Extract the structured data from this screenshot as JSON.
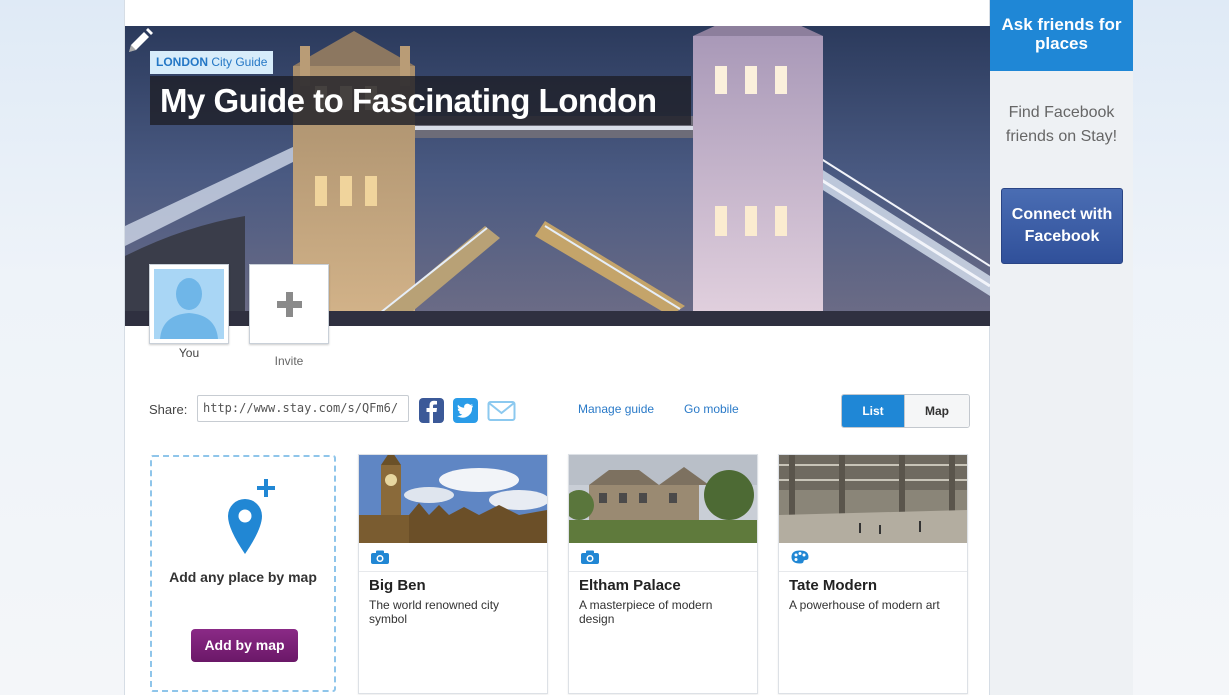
{
  "hero": {
    "city_name": "LONDON",
    "city_suffix": "City Guide",
    "title": "My Guide to Fascinating London",
    "edit_icon": "pencil-icon"
  },
  "members": {
    "you_label": "You",
    "invite_label": "Invite"
  },
  "share": {
    "label": "Share:",
    "url": "http://www.stay.com/s/QFm6/",
    "icons": [
      "facebook-icon",
      "twitter-icon",
      "email-icon"
    ],
    "manage_label": "Manage guide",
    "mobile_label": "Go mobile"
  },
  "view_toggle": {
    "list_label": "List",
    "map_label": "Map",
    "active": "List"
  },
  "add_place": {
    "text": "Add any place by map",
    "button_label": "Add by map"
  },
  "places": [
    {
      "name": "Big Ben",
      "description": "The world renowned city symbol",
      "category_icon": "camera-icon"
    },
    {
      "name": "Eltham Palace",
      "description": "A masterpiece of modern design",
      "category_icon": "camera-icon"
    },
    {
      "name": "Tate Modern",
      "description": "A powerhouse of modern art",
      "category_icon": "palette-icon"
    }
  ],
  "sidebar": {
    "ask_title": "Ask friends for places",
    "find_text": "Find Facebook friends on Stay!",
    "connect_label": "Connect with Facebook"
  },
  "colors": {
    "accent": "#1f87d6",
    "add_button": "#7a2076",
    "facebook": "#3b5998"
  }
}
